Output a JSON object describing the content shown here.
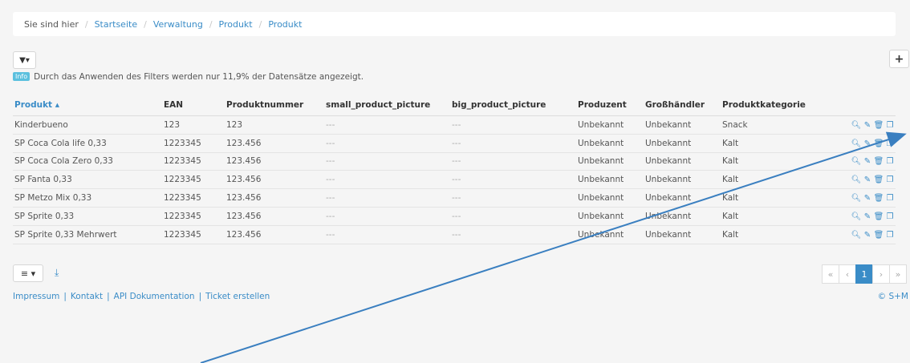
{
  "breadcrumb": {
    "here": "Sie sind hier",
    "items": [
      "Startseite",
      "Verwaltung",
      "Produkt",
      "Produkt"
    ]
  },
  "toolbar": {
    "filter_icon": "filter-icon",
    "filter_label": "▼▾",
    "add_label": "+"
  },
  "info": {
    "badge": "Info",
    "text": "Durch das Anwenden des Filters werden nur 11,9% der Datensätze angezeigt."
  },
  "table": {
    "headers": [
      "Produkt ▴",
      "EAN",
      "Produktnummer",
      "small_product_picture",
      "big_product_picture",
      "Produzent",
      "Großhändler",
      "Produktkategorie"
    ],
    "rows": [
      [
        "Kinderbueno",
        "123",
        "123",
        "---",
        "---",
        "Unbekannt",
        "Unbekannt",
        "Snack"
      ],
      [
        "SP Coca Cola life 0,33",
        "1223345",
        "123.456",
        "---",
        "---",
        "Unbekannt",
        "Unbekannt",
        "Kalt"
      ],
      [
        "SP Coca Cola Zero 0,33",
        "1223345",
        "123.456",
        "---",
        "---",
        "Unbekannt",
        "Unbekannt",
        "Kalt"
      ],
      [
        "SP Fanta 0,33",
        "1223345",
        "123.456",
        "---",
        "---",
        "Unbekannt",
        "Unbekannt",
        "Kalt"
      ],
      [
        "SP Metzo Mix 0,33",
        "1223345",
        "123.456",
        "---",
        "---",
        "Unbekannt",
        "Unbekannt",
        "Kalt"
      ],
      [
        "SP Sprite 0,33",
        "1223345",
        "123.456",
        "---",
        "---",
        "Unbekannt",
        "Unbekannt",
        "Kalt"
      ],
      [
        "SP Sprite 0,33 Mehrwert",
        "1223345",
        "123.456",
        "---",
        "---",
        "Unbekannt",
        "Unbekannt",
        "Kalt"
      ]
    ],
    "row_actions": [
      "search-icon",
      "pencil-icon",
      "trash-icon",
      "copy-icon"
    ]
  },
  "bottom": {
    "list_label": "≡ ▾",
    "download_icon": "download-icon"
  },
  "pagination": {
    "first": "«",
    "prev": "‹",
    "current": "1",
    "next": "›",
    "last": "»"
  },
  "footer": {
    "links": [
      "Impressum",
      "Kontakt",
      "API Dokumentation",
      "Ticket erstellen"
    ],
    "copyright": "© S+M"
  },
  "colors": {
    "accent": "#3a8cc7",
    "info_badge": "#5bc0de",
    "background": "#f5f5f5"
  }
}
